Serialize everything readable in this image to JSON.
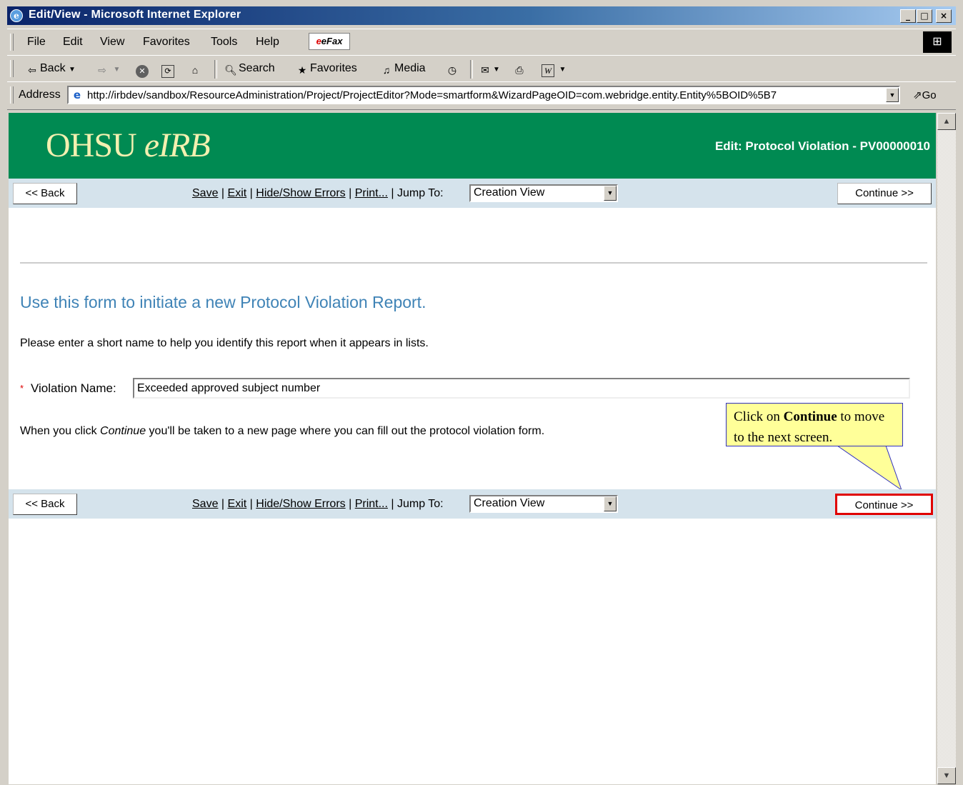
{
  "window": {
    "title": "Edit/View - Microsoft Internet Explorer",
    "minimize": "_",
    "maximize": "□",
    "close": "×"
  },
  "menu": {
    "items": [
      "File",
      "Edit",
      "View",
      "Favorites",
      "Tools",
      "Help"
    ],
    "efax": "eFax"
  },
  "toolbar": {
    "back": "Back",
    "search": "Search",
    "favorites": "Favorites",
    "media": "Media"
  },
  "address": {
    "label": "Address",
    "url": "http://irbdev/sandbox/ResourceAdministration/Project/ProjectEditor?Mode=smartform&WizardPageOID=com.webridge.entity.Entity%5BOID%5B7",
    "go": "Go"
  },
  "page": {
    "logo_main": "OHSU",
    "logo_italic": "eIRB",
    "edit_title": "Edit: Protocol Violation - PV00000010",
    "nav": {
      "back": "<< Back",
      "save": "Save",
      "exit": "Exit",
      "hide_show_errors": "Hide/Show Errors",
      "print": "Print...",
      "jump_to_label": "Jump To:",
      "jump_to_value": "Creation View",
      "continue": "Continue >>",
      "sep": "|"
    },
    "heading": "Use this form to initiate a new Protocol Violation Report.",
    "instruction": "Please enter a short name to help you identify this report when it appears in lists.",
    "required_marker": "*",
    "violation_name_label": "Violation Name:",
    "violation_name_value": "Exceeded approved subject number",
    "continue_text_pre": "When you click ",
    "continue_text_em": "Continue",
    "continue_text_post": " you'll be taken to a new page where you can fill out the protocol violation form.",
    "callout": {
      "pre": "Click on ",
      "bold": "Continue",
      "post": " to move to the next screen."
    }
  },
  "colors": {
    "banner": "#008a52",
    "logo": "#f3f0b0",
    "navbar": "#d5e3ec",
    "heading": "#3f83b6",
    "highlight": "#e00000",
    "callout_bg": "#ffff99"
  }
}
